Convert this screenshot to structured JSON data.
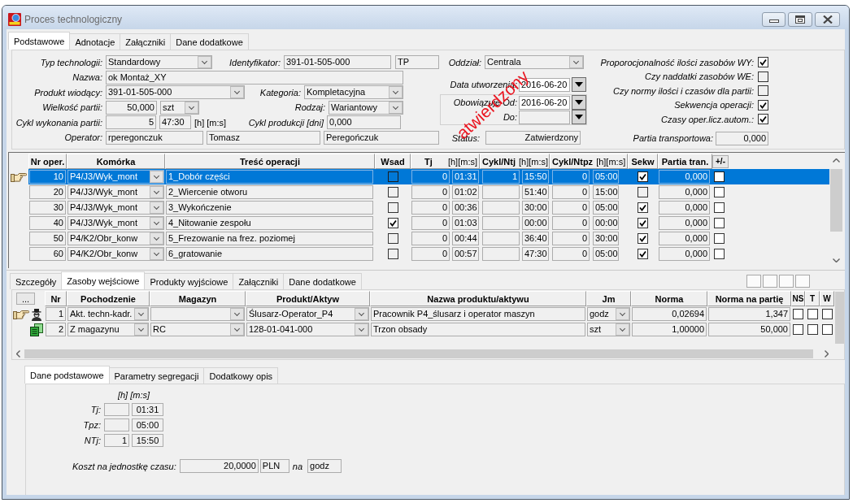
{
  "window": {
    "title": "Proces technologiczny"
  },
  "tabs": [
    {
      "label": "Podstawowe",
      "selected": true
    },
    {
      "label": "Adnotacje",
      "selected": false
    },
    {
      "label": "Załączniki",
      "selected": false
    },
    {
      "label": "Dane dodatkowe",
      "selected": false
    }
  ],
  "general": {
    "typ_technologii": {
      "label": "Typ technologii:",
      "value": "Standardowy"
    },
    "identyfikator": {
      "label": "Identyfikator:",
      "value": "391-01-505-000",
      "code": "TP"
    },
    "oddzial": {
      "label": "Oddział:",
      "value": "Centrala"
    },
    "nazwa": {
      "label": "Nazwa:",
      "value": "ok Montaż_XY"
    },
    "data_utworzenia": {
      "label": "Data utworzenia:",
      "value": "2016-06-20"
    },
    "produkt_wiodacy": {
      "label": "Produkt wiodący:",
      "value": "391-01-505-000"
    },
    "kategoria": {
      "label": "Kategoria:",
      "value": "Kompletacyjna"
    },
    "obowiazuje_od": {
      "label": "Obowiązuje Od:",
      "value": "2016-06-20"
    },
    "wielkosc_partii": {
      "label": "Wielkość partii:",
      "value": "50,000",
      "unit": "szt"
    },
    "rodzaj": {
      "label": "Rodzaj:",
      "value": "Wariantowy"
    },
    "obowiazuje_do": {
      "label": "Do:"
    },
    "cykl_wykonania_partii": {
      "label": "Cykl wykonania partii:",
      "hours": "5",
      "minutes_seconds": "47:30",
      "unit": "[h] [m:s]"
    },
    "cykl_produkcji": {
      "label": "Cykl produkcji [dni]",
      "value": "0,000"
    },
    "operator": {
      "label": "Operator:",
      "login": "rperegonczuk",
      "first_name": "Tomasz",
      "last_name": "Peregończuk"
    },
    "status": {
      "label": "Status:",
      "value": "Zatwierdzony"
    },
    "stamp": "atwierdzony",
    "options": [
      {
        "label": "Proporocjonalność ilości zasobów WY:",
        "checked": true
      },
      {
        "label": "Czy naddatki zasobów WE:",
        "checked": false
      },
      {
        "label": "Czy normy ilości i czasów dla partii:",
        "checked": false
      },
      {
        "label": "Sekwencja operacji:",
        "checked": true
      },
      {
        "label": "Czasy oper.licz.autom.:",
        "checked": true
      }
    ],
    "partia_transportowa": {
      "label": "Partia transportowa:",
      "value": "0,000"
    }
  },
  "operations": {
    "columns": [
      {
        "label": "Nr oper.",
        "kind": "header"
      },
      {
        "label": "Komórka",
        "kind": "header"
      },
      {
        "label": "Treść operacji",
        "kind": "header"
      },
      {
        "label": "Wsad",
        "kind": "header"
      },
      {
        "label": "Tj",
        "unit": "[h][m:s]",
        "kind": "header"
      },
      {
        "label": "Cykl/Ntj",
        "unit": "[h][m:s]",
        "kind": "header"
      },
      {
        "label": "Cykl/Ntpz",
        "unit": "[h][m:s]",
        "kind": "header"
      },
      {
        "label": "Sekw",
        "kind": "header"
      },
      {
        "label": "Partia tran.",
        "kind": "header"
      },
      {
        "label": "+/-",
        "kind": "button"
      }
    ],
    "rows": [
      {
        "nr": "10",
        "komorka": "P4/J3/Wyk_mont",
        "tresc": "1_Dobór części",
        "wsad": false,
        "tj_h": "0",
        "tj_ms": "01:31",
        "ntj_h": "1",
        "ntj_ms": "15:50",
        "ntpz_h": "0",
        "ntpz_ms": "05:00",
        "sekw": true,
        "partia_tran": "0,000",
        "plus_minus": false,
        "selected": true
      },
      {
        "nr": "20",
        "komorka": "P4/J3/Wyk_mont",
        "tresc": "2_Wiercenie otworu",
        "wsad": false,
        "tj_h": "0",
        "tj_ms": "01:02",
        "ntj_ms": "51:40",
        "ntpz_h": "0",
        "ntpz_ms": "15:00",
        "sekw": false,
        "partia_tran": "0,000",
        "plus_minus": false,
        "selected": false
      },
      {
        "nr": "30",
        "komorka": "P4/J3/Wyk_mont",
        "tresc": "3_Wykończenie",
        "wsad": false,
        "tj_h": "0",
        "tj_ms": "00:36",
        "ntj_ms": "30:00",
        "ntpz_h": "0",
        "ntpz_ms": "05:00",
        "sekw": true,
        "partia_tran": "0,000",
        "plus_minus": false,
        "selected": false
      },
      {
        "nr": "40",
        "komorka": "P4/J3/Wyk_mont",
        "tresc": "4_Nitowanie zespołu",
        "wsad": true,
        "tj_h": "0",
        "tj_ms": "01:03",
        "ntj_ms": "00:00",
        "ntpz_h": "0",
        "ntpz_ms": "00:00",
        "sekw": true,
        "partia_tran": "0,000",
        "plus_minus": false,
        "selected": false
      },
      {
        "nr": "50",
        "komorka": "P4/K2/Obr_konw",
        "tresc": "5_Frezowanie na frez. poziomej",
        "wsad": false,
        "tj_h": "0",
        "tj_ms": "00:44",
        "ntj_ms": "36:40",
        "ntpz_h": "0",
        "ntpz_ms": "30:00",
        "sekw": true,
        "partia_tran": "0,000",
        "plus_minus": false,
        "selected": false
      },
      {
        "nr": "60",
        "komorka": "P4/K2/Obr_konw",
        "tresc": "6_gratowanie",
        "wsad": false,
        "tj_h": "0",
        "tj_ms": "00:57",
        "ntj_ms": "47:30",
        "ntpz_h": "0",
        "ntpz_ms": "05:00",
        "sekw": true,
        "partia_tran": "0,000",
        "plus_minus": false,
        "selected": false
      }
    ]
  },
  "detail_tabs": [
    {
      "label": "Szczegóły",
      "selected": false
    },
    {
      "label": "Zasoby wejściowe",
      "selected": true
    },
    {
      "label": "Produkty wyjściowe",
      "selected": false
    },
    {
      "label": "Załączniki",
      "selected": false
    },
    {
      "label": "Dane dodatkowe",
      "selected": false
    }
  ],
  "resources": {
    "columns": [
      {
        "label": "...",
        "kind": "button"
      },
      {
        "label": "Nr",
        "kind": "header"
      },
      {
        "label": "Pochodzenie",
        "kind": "header"
      },
      {
        "label": "Magazyn",
        "kind": "header"
      },
      {
        "label": "Produkt/Aktyw",
        "kind": "header"
      },
      {
        "label": "Nazwa produktu/aktywu",
        "kind": "header"
      },
      {
        "label": "Jm",
        "kind": "header"
      },
      {
        "label": "Norma",
        "kind": "header"
      },
      {
        "label": "Norma na partię",
        "kind": "header"
      },
      {
        "label": "NS",
        "kind": "header"
      },
      {
        "label": "T",
        "kind": "header"
      },
      {
        "label": "W",
        "kind": "header"
      }
    ],
    "rows": [
      {
        "kind": "employee",
        "current": true,
        "nr": "1",
        "pochodzenie": "Akt. techn-kadr.",
        "produkt": "Ślusarz-Operator_P4",
        "nazwa": "Pracownik P4_ślusarz i operator maszyn",
        "jm": "godz",
        "norma": "0,02694",
        "norma_partia": "1,347",
        "ns": false,
        "t": false,
        "w": false
      },
      {
        "kind": "stock",
        "current": false,
        "nr": "2",
        "pochodzenie": "Z magazynu",
        "magazyn": "RC",
        "produkt": "128-01-041-000",
        "nazwa": "Trzon obsady",
        "jm": "szt",
        "norma": "1,00000",
        "norma_partia": "50,000",
        "ns": false,
        "t": false,
        "w": false
      }
    ]
  },
  "resource_tabs": [
    {
      "label": "Dane podstawowe",
      "selected": true
    },
    {
      "label": "Parametry segregacji",
      "selected": false
    },
    {
      "label": "Dodatkowy opis",
      "selected": false
    }
  ],
  "basic_data": {
    "unit_header": "[h] [m:s]",
    "times": [
      {
        "label": "Tj:",
        "minutes_seconds": "01:31"
      },
      {
        "label": "Tpz:",
        "minutes_seconds": "05:00"
      },
      {
        "label": "NTj:",
        "hours": "1",
        "minutes_seconds": "15:50"
      }
    ],
    "cost": {
      "label": "Koszt na jednostkę czasu:",
      "value": "20,0000",
      "currency": "PLN",
      "per_label": "na",
      "per_unit": "godz"
    }
  }
}
